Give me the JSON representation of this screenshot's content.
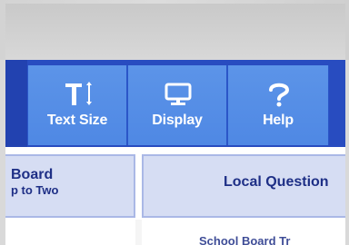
{
  "toolbar": {
    "buttons": [
      {
        "label": "Text Size",
        "icon": "text-size-icon"
      },
      {
        "label": "Display",
        "icon": "monitor-icon"
      },
      {
        "label": "Help",
        "icon": "question-mark-icon"
      }
    ]
  },
  "cards": {
    "left": {
      "title": "Board",
      "subtitle": "p to Two"
    },
    "right": {
      "title": "Local Question"
    }
  },
  "lower": {
    "partial_text": "School Board Tr"
  },
  "colors": {
    "toolbar_bg": "#284cc0",
    "toolbar_button": "#5c94e8",
    "card_bg": "#d6ddf3",
    "card_text": "#1e2f86"
  }
}
